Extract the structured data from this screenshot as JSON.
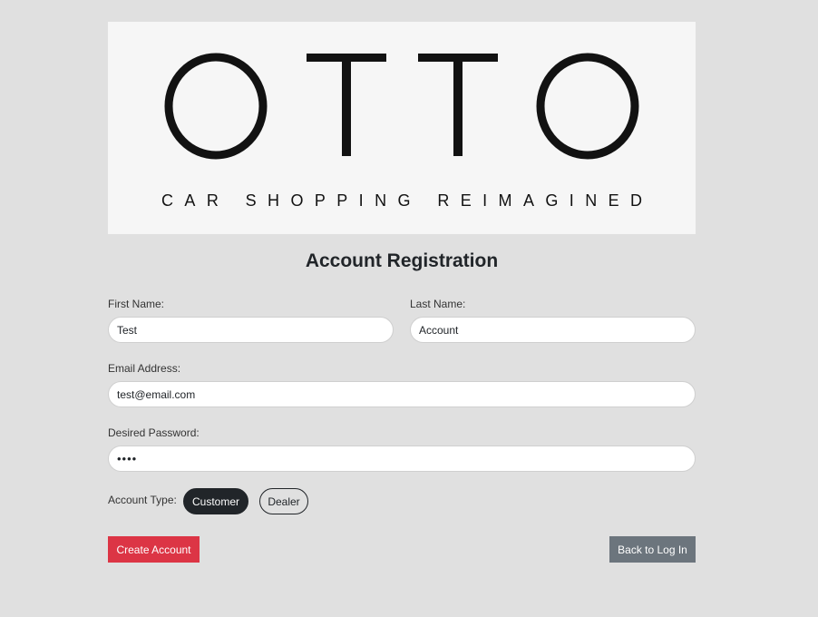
{
  "logo": {
    "wordmark": "OTTO",
    "tagline": "CAR SHOPPING REIMAGINED"
  },
  "title": "Account Registration",
  "form": {
    "first_name": {
      "label": "First Name:",
      "value": "Test"
    },
    "last_name": {
      "label": "Last Name:",
      "value": "Account"
    },
    "email": {
      "label": "Email Address:",
      "value": "test@email.com"
    },
    "password": {
      "label": "Desired Password:",
      "value": "••••"
    },
    "account_type": {
      "label": "Account Type:",
      "options": [
        "Customer",
        "Dealer"
      ],
      "selected": "Customer"
    }
  },
  "buttons": {
    "create": "Create Account",
    "back": "Back to Log In"
  },
  "colors": {
    "background": "#e0e0e0",
    "create_button": "#dc3545",
    "back_button": "#6c757d",
    "selected_pill": "#212529"
  }
}
